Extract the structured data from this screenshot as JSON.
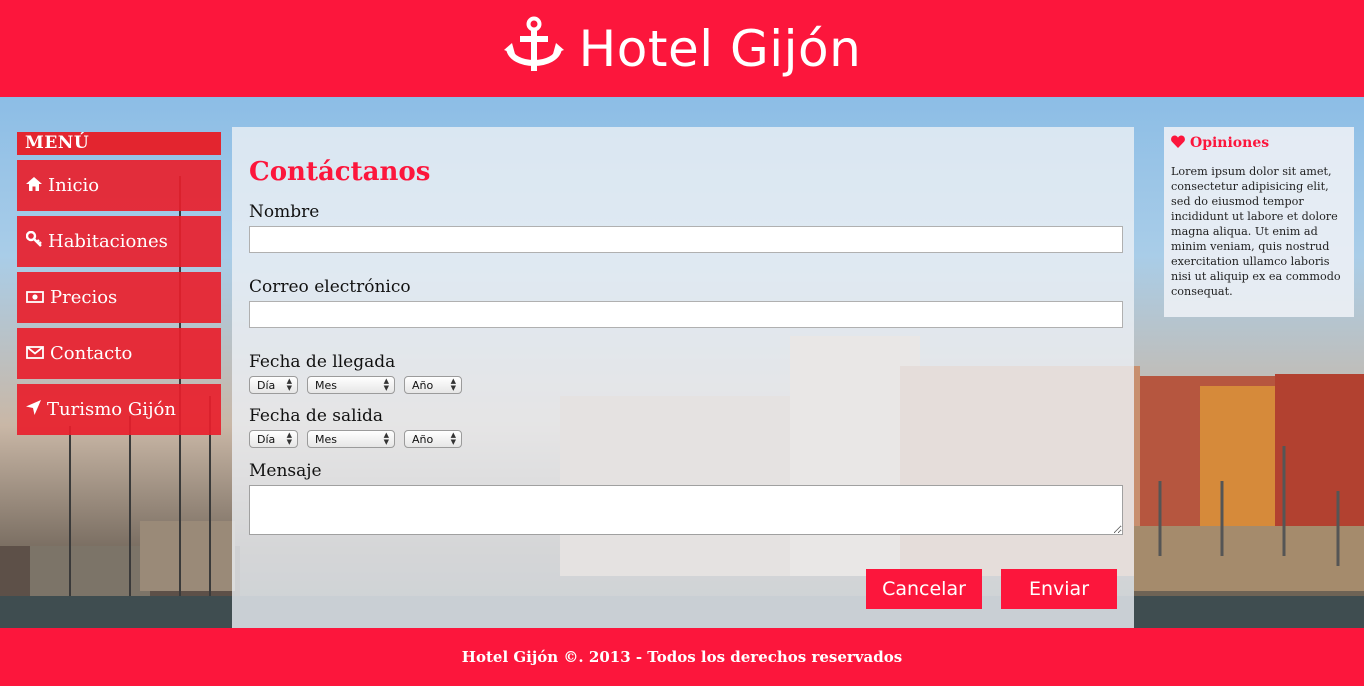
{
  "header": {
    "title": "Hotel Gijón",
    "logo_icon": "anchor-icon"
  },
  "menu": {
    "title": "MENÚ",
    "items": [
      {
        "label": "Inicio",
        "icon": "home-icon"
      },
      {
        "label": "Habitaciones",
        "icon": "key-icon"
      },
      {
        "label": "Precios",
        "icon": "money-icon"
      },
      {
        "label": "Contacto",
        "icon": "envelope-icon"
      },
      {
        "label": "Turismo Gijón",
        "icon": "location-arrow-icon"
      }
    ]
  },
  "form": {
    "title": "Contáctanos",
    "name_label": "Nombre",
    "name_value": "",
    "email_label": "Correo electrónico",
    "email_value": "",
    "arrival_label": "Fecha de llegada",
    "departure_label": "Fecha de salida",
    "day_selected": "Día",
    "month_selected": "Mes",
    "year_selected": "Año",
    "message_label": "Mensaje",
    "message_value": "",
    "cancel_label": "Cancelar",
    "submit_label": "Enviar"
  },
  "sidebar": {
    "title": "Opiniones",
    "icon": "heart-icon",
    "text": "Lorem ipsum dolor sit amet, consectetur adipisicing elit, sed do eiusmod tempor incididunt ut labore et dolore magna aliqua. Ut enim ad minim veniam, quis nostrud exercitation ullamco laboris nisi ut aliquip ex ea commodo consequat."
  },
  "footer": {
    "text": "Hotel Gijón ©. 2013 - Todos los derechos reservados"
  },
  "colors": {
    "brand": "#fc163c",
    "menu_item": "#e8202c",
    "panel": "#eceff5"
  }
}
